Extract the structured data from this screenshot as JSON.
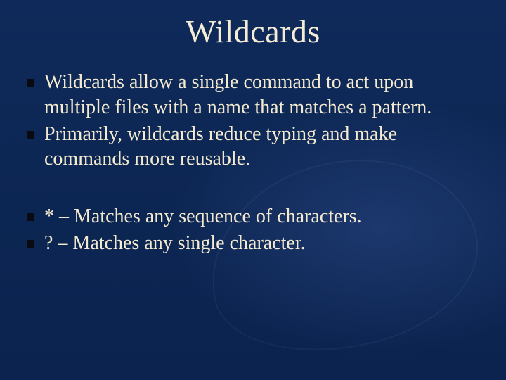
{
  "slide": {
    "title": "Wildcards",
    "group1": [
      {
        "text": "Wildcards allow a single command to act upon multiple files with a name that matches a pattern."
      },
      {
        "text": "Primarily, wildcards reduce typing and make commands more reusable."
      }
    ],
    "group2": [
      {
        "text": "* – Matches any sequence of characters."
      },
      {
        "text": "? – Matches any single character."
      }
    ]
  }
}
